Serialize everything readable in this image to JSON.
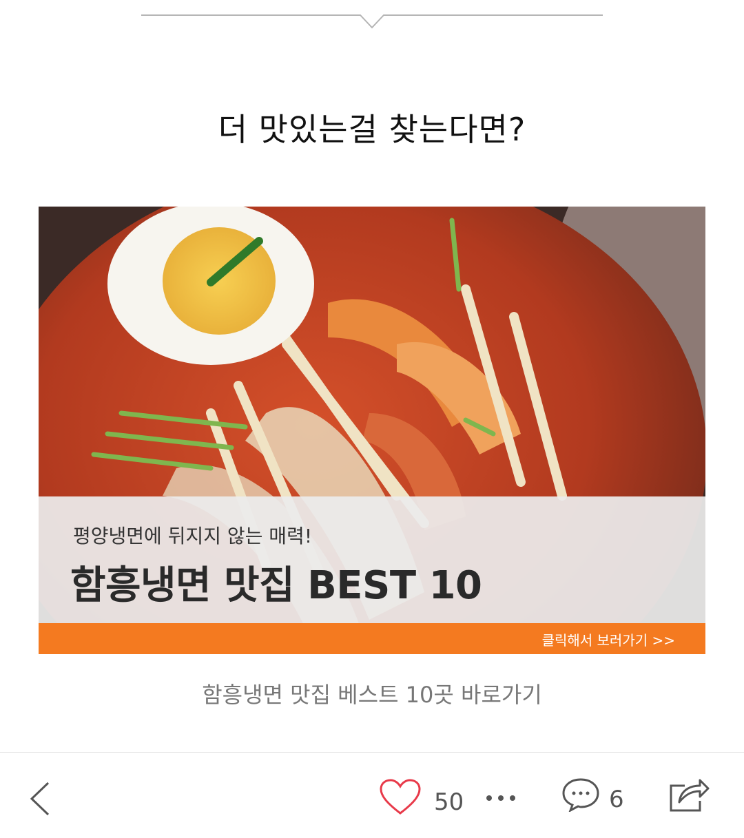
{
  "heading": "더 맛있는걸 찾는다면?",
  "banner": {
    "subtitle": "평양냉면에 뒤지지 않는 매력!",
    "title": "함흥냉면 맛집 BEST 10",
    "cta": "클릭해서 보러가기 >>",
    "accent_color": "#f47a20"
  },
  "caption": "함흥냉면 맛집 베스트 10곳 바로가기",
  "toolbar": {
    "back_icon": "chevron-left-icon",
    "like_icon": "heart-icon",
    "like_count": "50",
    "more_icon": "ellipsis-icon",
    "comment_icon": "speech-bubble-icon",
    "comment_count": "6",
    "share_icon": "share-icon"
  }
}
